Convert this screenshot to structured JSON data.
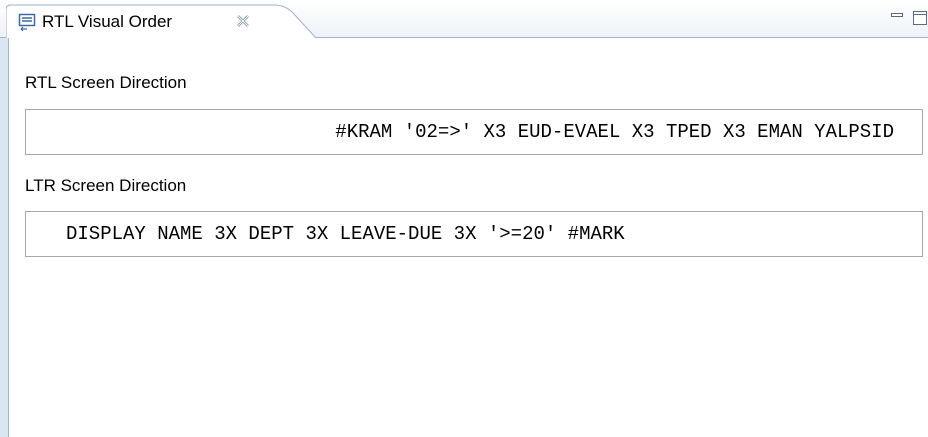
{
  "view": {
    "title": "RTL Visual Order",
    "icon": "view-icon"
  },
  "controls": {
    "minimize": "minimize-icon",
    "maximize": "maximize-icon"
  },
  "rtl_section": {
    "label": "RTL Screen Direction",
    "text": "#KRAM '02=>' X3 EUD-EVAEL X3 TPED X3 EMAN YALPSID"
  },
  "ltr_section": {
    "label": "LTR Screen Direction",
    "text": "DISPLAY NAME 3X DEPT 3X LEAVE-DUE 3X '>=20' #MARK"
  },
  "colors": {
    "frame": "#dce6f1",
    "border": "#9fb3cc",
    "box_border": "#a8a8a8"
  }
}
